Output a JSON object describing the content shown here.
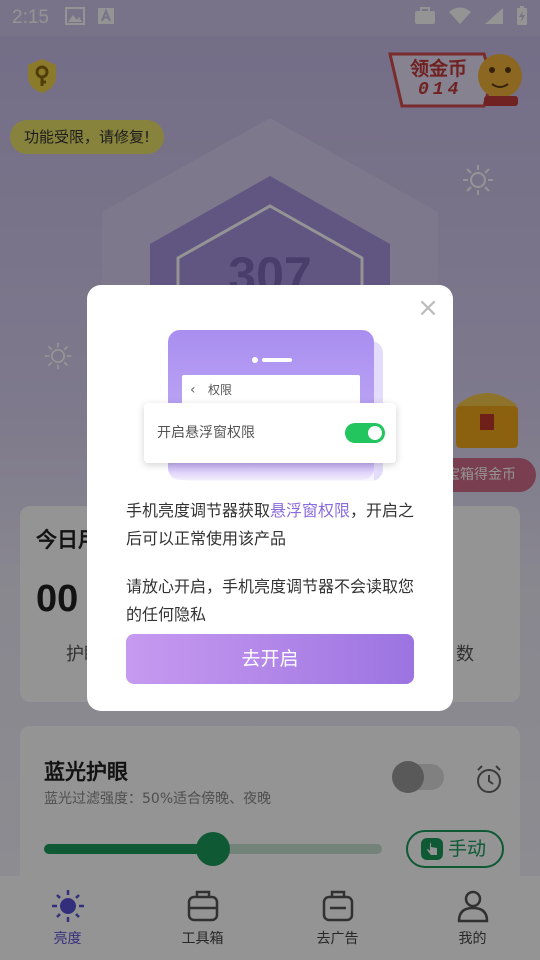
{
  "status_bar": {
    "time": "2:15"
  },
  "header": {
    "limit_tip": "功能受限，请修复!",
    "coin_banner_title": "领金币",
    "coin_banner_count": "014"
  },
  "main": {
    "brightness_value": "307",
    "chest_label": "宝箱得金币"
  },
  "today_card": {
    "title": "今日用",
    "value": "00",
    "sub_left": "护眼",
    "sub_right": "数"
  },
  "blue_light": {
    "title": "蓝光护眼",
    "desc": "蓝光过滤强度：50%适合傍晚、夜晚",
    "toggle_on": false,
    "level": 0.5,
    "manual_label": "手动"
  },
  "tabs": [
    {
      "label": "亮度",
      "icon": "sun-icon",
      "active": true
    },
    {
      "label": "工具箱",
      "icon": "toolbox-icon",
      "active": false
    },
    {
      "label": "去广告",
      "icon": "ad-box-icon",
      "active": false
    },
    {
      "label": "我的",
      "icon": "user-icon",
      "active": false
    }
  ],
  "dialog": {
    "illus_bar_label": "权限",
    "illus_card_label": "开启悬浮窗权限",
    "illus_toggle_on": true,
    "msg1_pre": "手机亮度调节器获取",
    "msg1_link": "悬浮窗权限",
    "msg1_post": "，开启之后可以正常使用该产品",
    "msg2": "请放心开启，手机亮度调节器不会读取您的任何隐私",
    "button_label": "去开启"
  },
  "colors": {
    "accent": "#8b6be0",
    "green": "#1a9a5a",
    "toggle_green": "#22c55e",
    "tip_yellow": "#e9e26a"
  }
}
